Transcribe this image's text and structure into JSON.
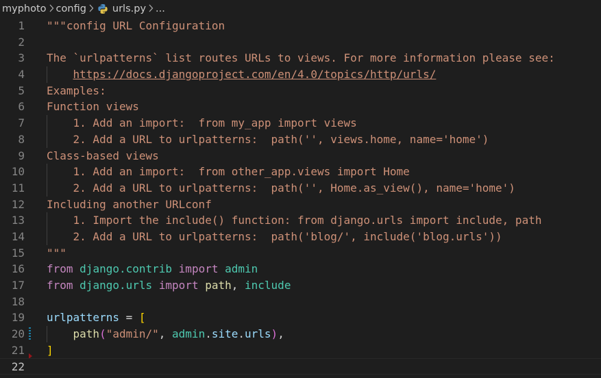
{
  "breadcrumb": {
    "items": [
      "myphoto",
      "config",
      "urls.py",
      "..."
    ]
  },
  "colors": {
    "background": "#1e1e1e",
    "string": "#ce9178",
    "keyword": "#c586c0",
    "module": "#4ec9b0",
    "function": "#dcdcaa",
    "variable": "#9cdcfe",
    "bracket": "#ffd700",
    "line_number": "#858585"
  },
  "editor": {
    "current_line": 22,
    "lines": [
      {
        "n": "1",
        "tokens": [
          [
            "str",
            "\"\"\"config URL Configuration"
          ]
        ]
      },
      {
        "n": "2",
        "tokens": []
      },
      {
        "n": "3",
        "tokens": [
          [
            "str",
            "The `urlpatterns` list routes URLs to views. For more information please see:"
          ]
        ]
      },
      {
        "n": "4",
        "tokens": [
          [
            "str",
            "    "
          ],
          [
            "link",
            "https://docs.djangoproject.com/en/4.0/topics/http/urls/"
          ]
        ]
      },
      {
        "n": "5",
        "tokens": [
          [
            "str",
            "Examples:"
          ]
        ]
      },
      {
        "n": "6",
        "tokens": [
          [
            "str",
            "Function views"
          ]
        ]
      },
      {
        "n": "7",
        "tokens": [
          [
            "str",
            "    1. Add an import:  from my_app import views"
          ]
        ]
      },
      {
        "n": "8",
        "tokens": [
          [
            "str",
            "    2. Add a URL to urlpatterns:  path('', views.home, name='home')"
          ]
        ]
      },
      {
        "n": "9",
        "tokens": [
          [
            "str",
            "Class-based views"
          ]
        ]
      },
      {
        "n": "10",
        "tokens": [
          [
            "str",
            "    1. Add an import:  from other_app.views import Home"
          ]
        ]
      },
      {
        "n": "11",
        "tokens": [
          [
            "str",
            "    2. Add a URL to urlpatterns:  path('', Home.as_view(), name='home')"
          ]
        ]
      },
      {
        "n": "12",
        "tokens": [
          [
            "str",
            "Including another URLconf"
          ]
        ]
      },
      {
        "n": "13",
        "tokens": [
          [
            "str",
            "    1. Import the include() function: from django.urls import include, path"
          ]
        ]
      },
      {
        "n": "14",
        "tokens": [
          [
            "str",
            "    2. Add a URL to urlpatterns:  path('blog/', include('blog.urls'))"
          ]
        ]
      },
      {
        "n": "15",
        "tokens": [
          [
            "str",
            "\"\"\""
          ]
        ]
      },
      {
        "n": "16",
        "tokens": [
          [
            "kw",
            "from"
          ],
          [
            "pun",
            " "
          ],
          [
            "mod-n",
            "django.contrib"
          ],
          [
            "pun",
            " "
          ],
          [
            "kw",
            "import"
          ],
          [
            "pun",
            " "
          ],
          [
            "mod-n",
            "admin"
          ]
        ]
      },
      {
        "n": "17",
        "tokens": [
          [
            "kw",
            "from"
          ],
          [
            "pun",
            " "
          ],
          [
            "mod-n",
            "django.urls"
          ],
          [
            "pun",
            " "
          ],
          [
            "kw",
            "import"
          ],
          [
            "pun",
            " "
          ],
          [
            "fn",
            "path"
          ],
          [
            "pun",
            ", "
          ],
          [
            "mod-n",
            "include"
          ]
        ]
      },
      {
        "n": "18",
        "tokens": []
      },
      {
        "n": "19",
        "tokens": [
          [
            "var",
            "urlpatterns"
          ],
          [
            "pun",
            " = "
          ],
          [
            "brk",
            "["
          ]
        ]
      },
      {
        "n": "20",
        "tokens": [
          [
            "pun",
            "    "
          ],
          [
            "fn",
            "path"
          ],
          [
            "brk2",
            "("
          ],
          [
            "str",
            "\"admin/\""
          ],
          [
            "pun",
            ", "
          ],
          [
            "mod-n",
            "admin"
          ],
          [
            "pun",
            "."
          ],
          [
            "var",
            "site"
          ],
          [
            "pun",
            "."
          ],
          [
            "var",
            "urls"
          ],
          [
            "brk2",
            ")"
          ],
          [
            "pun",
            ","
          ]
        ]
      },
      {
        "n": "21",
        "tokens": [
          [
            "brk",
            "]"
          ]
        ]
      },
      {
        "n": "22",
        "tokens": []
      }
    ]
  }
}
